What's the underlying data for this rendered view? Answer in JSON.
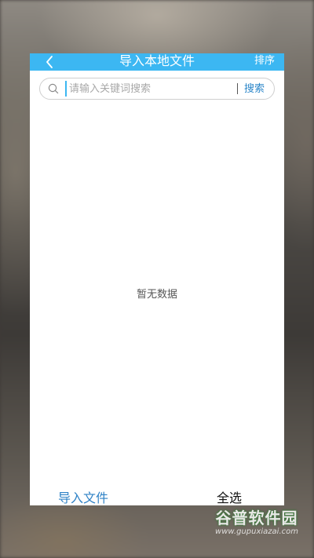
{
  "header": {
    "title": "导入本地文件",
    "sort_label": "排序",
    "back_icon": "chevron-left-icon",
    "background_color": "#3cb7f2"
  },
  "search": {
    "placeholder": "请输入关键词搜索",
    "value": "",
    "button_label": "搜索",
    "icon": "search-icon"
  },
  "content": {
    "empty_text": "暂无数据"
  },
  "footer": {
    "import_label": "导入文件",
    "select_all_label": "全选",
    "import_color": "#2f82c6"
  },
  "watermark": {
    "logo_text": "谷普软件园",
    "url": "www.gupuxiazai.com"
  }
}
